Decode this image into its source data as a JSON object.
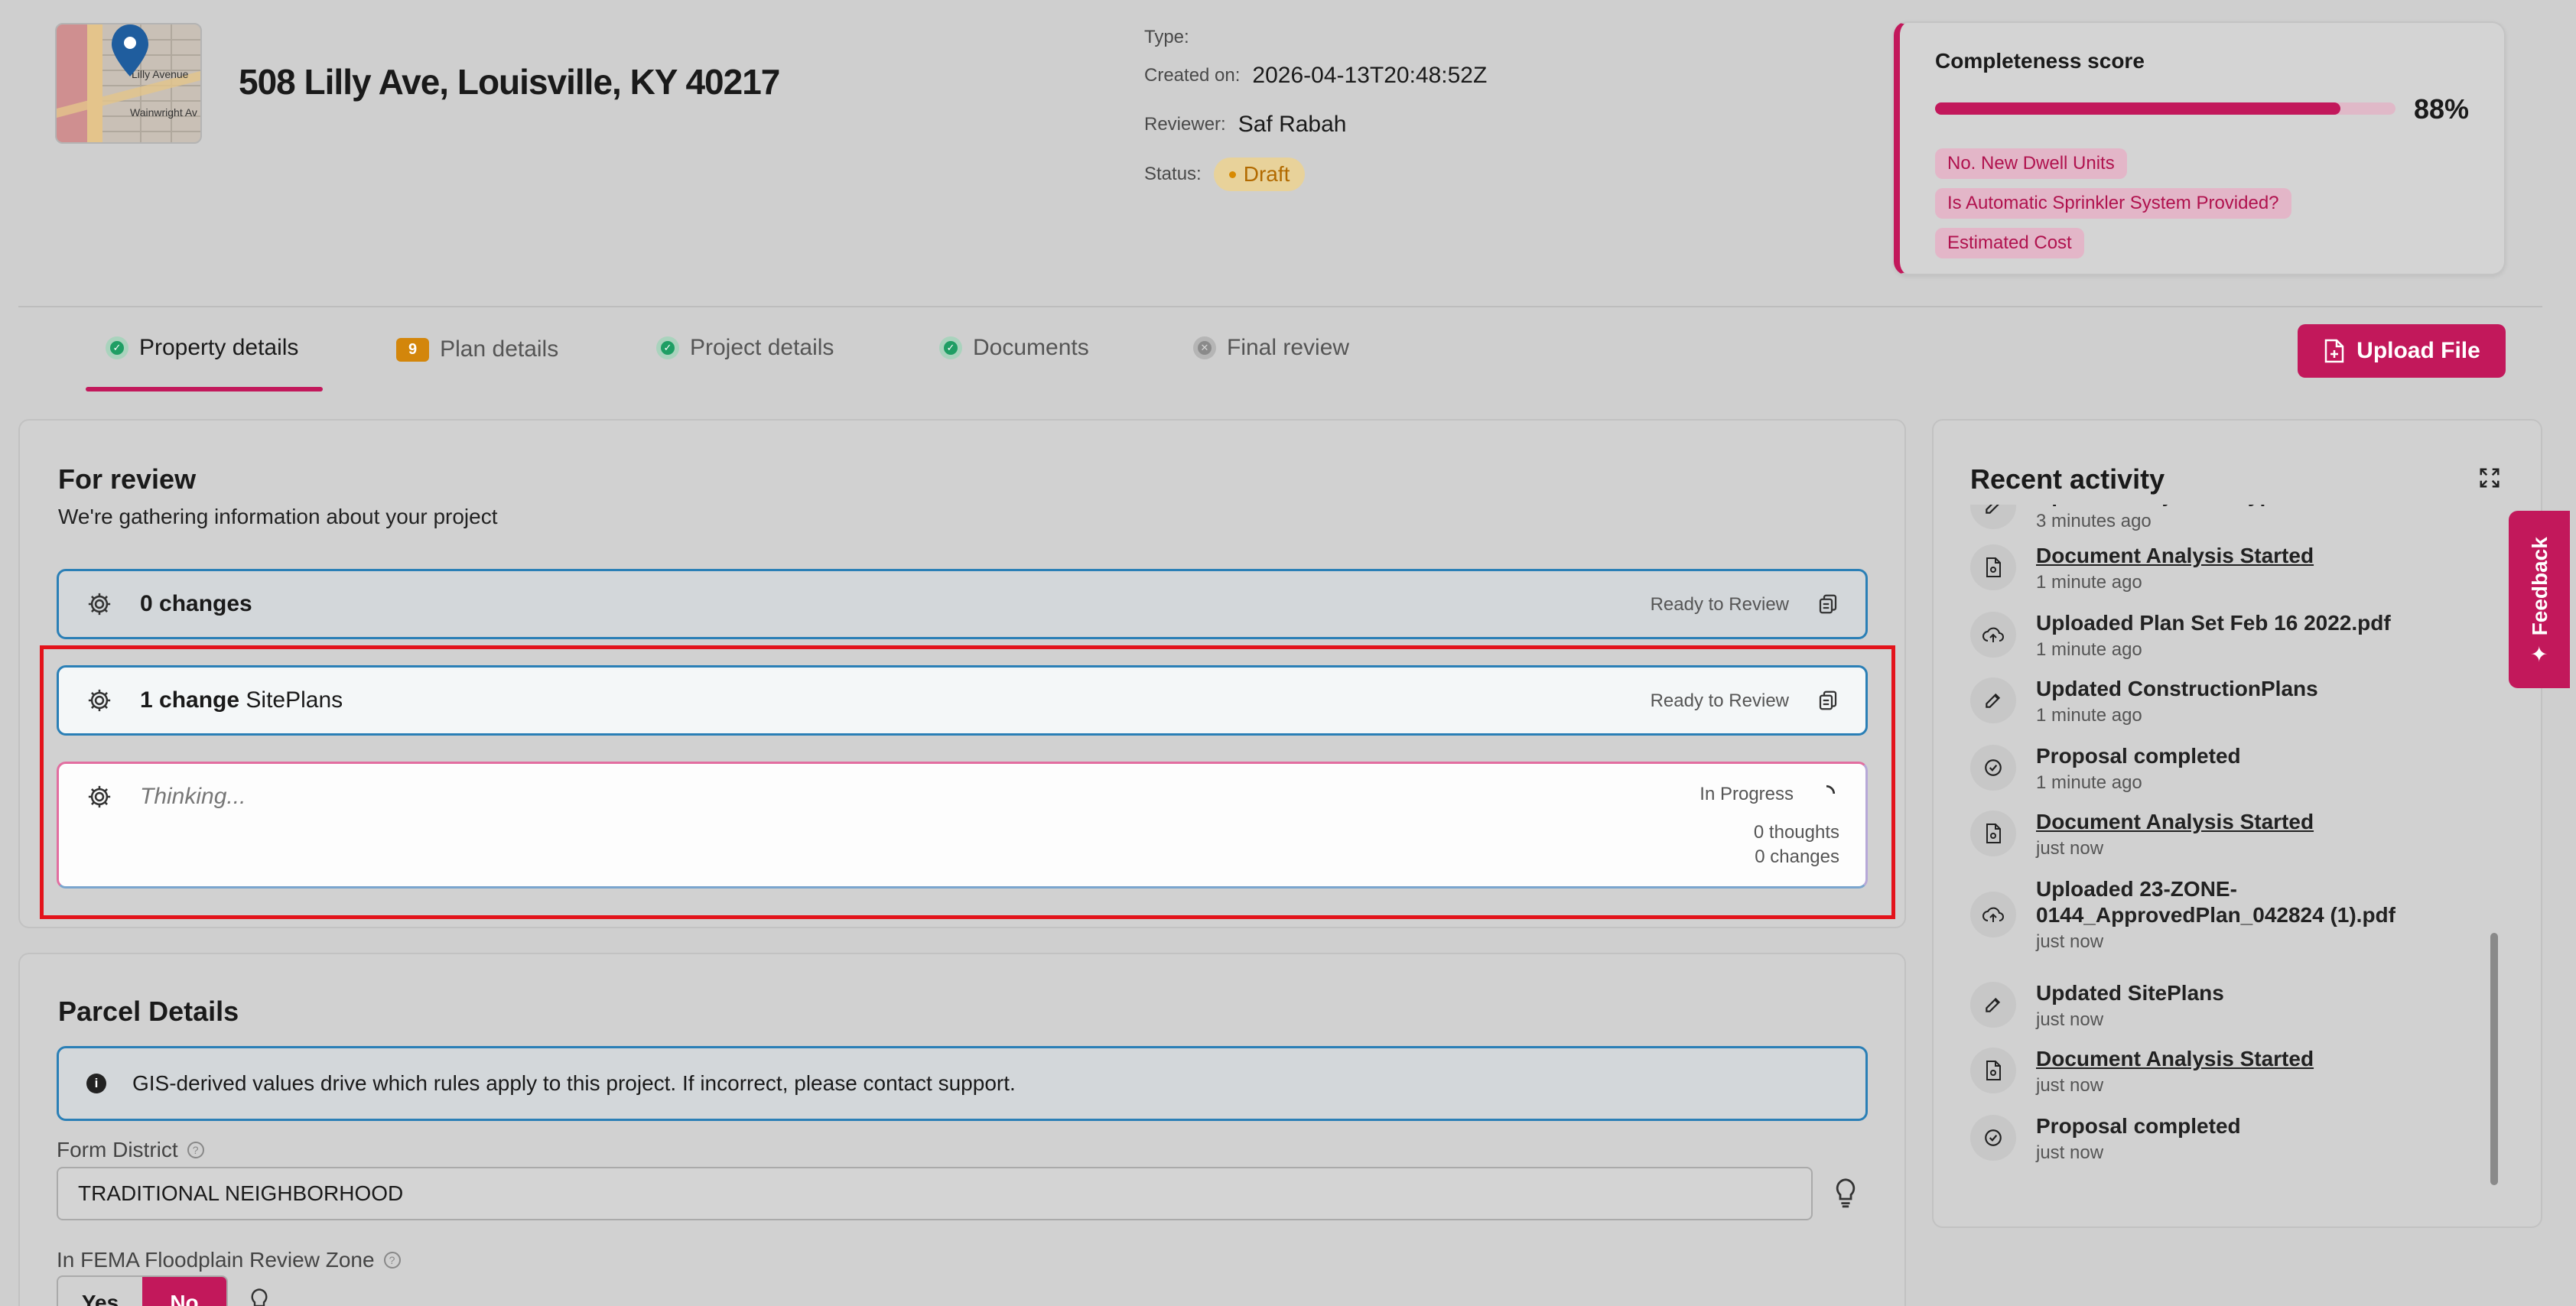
{
  "header": {
    "address": "508 Lilly Ave, Louisville, KY 40217",
    "map_labels": [
      "Lilly Avenue",
      "Wainwright Av"
    ],
    "type_label": "Type:",
    "type_value": "",
    "created_label": "Created on:",
    "created_value": "2026-04-13T20:48:52Z",
    "reviewer_label": "Reviewer:",
    "reviewer_value": "Saf Rabah",
    "status_label": "Status:",
    "status_value": "Draft"
  },
  "score": {
    "title": "Completeness score",
    "percent_text": "88%",
    "percent": 88,
    "missing": [
      "No. New Dwell Units",
      "Is Automatic Sprinkler System Provided?",
      "Estimated Cost"
    ]
  },
  "tabs": [
    {
      "label": "Property details",
      "state": "complete",
      "active": true
    },
    {
      "label": "Plan details",
      "state": "count",
      "count": "9",
      "active": false
    },
    {
      "label": "Project details",
      "state": "complete",
      "active": false
    },
    {
      "label": "Documents",
      "state": "complete",
      "active": false
    },
    {
      "label": "Final review",
      "state": "error",
      "active": false
    }
  ],
  "upload_button": "Upload File",
  "review": {
    "title": "For review",
    "subtitle": "We're gathering information about your project",
    "rows": [
      {
        "count": "0 changes",
        "name": "",
        "status": "Ready to Review"
      },
      {
        "count": "1 change",
        "name": "SitePlans",
        "status": "Ready to Review"
      },
      {
        "thinking": "Thinking...",
        "status": "In Progress",
        "thoughts": "0 thoughts",
        "changes": "0 changes"
      }
    ]
  },
  "parcel": {
    "title": "Parcel Details",
    "info": "GIS-derived values drive which rules apply to this project. If incorrect, please contact support.",
    "form_district_label": "Form District",
    "form_district_value": "TRADITIONAL NEIGHBORHOOD",
    "floodplain_label": "In FEMA Floodplain Review Zone",
    "yes_label": "Yes",
    "no_label": "No"
  },
  "activity": {
    "title": "Recent activity",
    "items": [
      {
        "icon": "edit-icon",
        "title": "Updated ProjectSubtype",
        "time": "3 minutes ago",
        "link": false
      },
      {
        "icon": "document-icon",
        "title": "Document Analysis Started",
        "time": "1 minute ago",
        "link": true
      },
      {
        "icon": "cloud-upload-icon",
        "title": "Uploaded Plan Set Feb 16 2022.pdf",
        "time": "1 minute ago",
        "link": false
      },
      {
        "icon": "edit-icon",
        "title": "Updated ConstructionPlans",
        "time": "1 minute ago",
        "link": false
      },
      {
        "icon": "check-circle-icon",
        "title": "Proposal completed",
        "time": "1 minute ago",
        "link": false
      },
      {
        "icon": "document-icon",
        "title": "Document Analysis Started",
        "time": "just now",
        "link": true
      },
      {
        "icon": "cloud-upload-icon",
        "title": "Uploaded 23-ZONE-0144_ApprovedPlan_042824 (1).pdf",
        "time": "just now",
        "link": false
      },
      {
        "icon": "edit-icon",
        "title": "Updated SitePlans",
        "time": "just now",
        "link": false
      },
      {
        "icon": "document-icon",
        "title": "Document Analysis Started",
        "time": "just now",
        "link": true
      },
      {
        "icon": "check-circle-icon",
        "title": "Proposal completed",
        "time": "just now",
        "link": false
      }
    ]
  },
  "feedback": "Feedback",
  "colors": {
    "accent": "#c2185b",
    "info_border": "#2a7fb6",
    "highlight": "#e3131b",
    "draft": "#d88a00"
  }
}
